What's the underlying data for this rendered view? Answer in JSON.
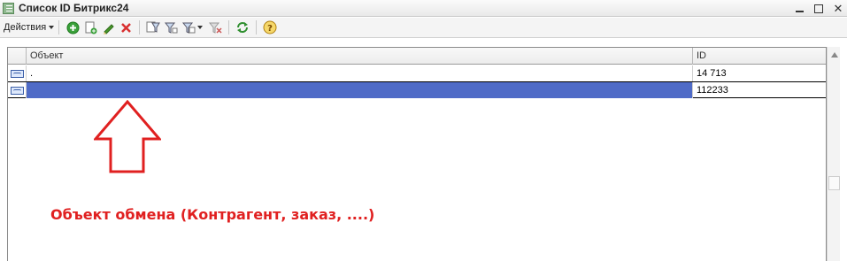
{
  "window": {
    "title": "Список ID Битрикс24"
  },
  "toolbar": {
    "actions_label": "Действия",
    "icons": [
      "add-icon",
      "copy-icon",
      "edit-icon",
      "delete-icon",
      "filter-icon",
      "filter-by-value-icon",
      "filter-settings-icon",
      "clear-filter-icon",
      "refresh-icon",
      "help-icon"
    ],
    "colors": {
      "add": "#3aa03a",
      "edit": "#4a9a2a",
      "delete": "#d83030",
      "refresh": "#2f8f2f",
      "help": "#e0a020"
    }
  },
  "table": {
    "columns": [
      "Объект",
      "ID"
    ],
    "rows": [
      {
        "object": ".",
        "id": "14 713",
        "selected": false
      },
      {
        "object": "",
        "id": "112233",
        "selected": true
      }
    ],
    "selection_color": "#4f6bc7"
  },
  "annotation": {
    "text": "Объект обмена (Контрагент, заказ, ....)",
    "color": "#e02020"
  }
}
